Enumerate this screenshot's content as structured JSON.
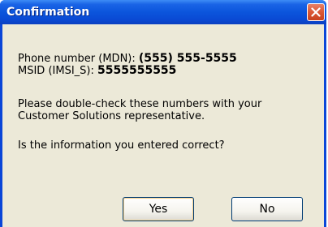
{
  "dialog": {
    "title": "Confirmation",
    "phone_label": "Phone number (MDN): ",
    "phone_value": "(555) 555-5555",
    "msid_label": "MSID (IMSI_S): ",
    "msid_value": "5555555555",
    "note_line1": "Please double-check these numbers with your",
    "note_line2": "Customer Solutions representative.",
    "question": "Is the information you entered correct?",
    "yes_label": "Yes",
    "no_label": "No",
    "close_icon": "close-icon"
  },
  "colors": {
    "titlebar": "#0b55dc",
    "client": "#ece9d8",
    "close_button": "#dc5a38"
  }
}
